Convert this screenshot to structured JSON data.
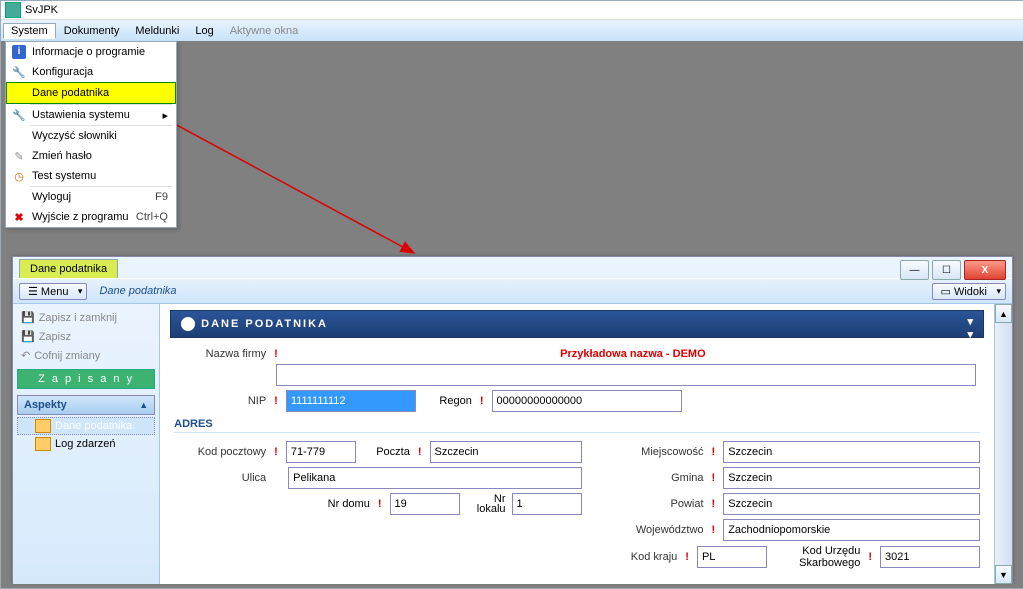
{
  "title": "SvJPK",
  "menu": {
    "system": "System",
    "dokumenty": "Dokumenty",
    "meldunki": "Meldunki",
    "log": "Log",
    "aktywne": "Aktywne okna"
  },
  "dropdown": {
    "info": "Informacje o programie",
    "konfig": "Konfiguracja",
    "dane": "Dane podatnika",
    "ustaw": "Ustawienia systemu",
    "wyczysc": "Wyczyść słowniki",
    "zmien": "Zmień hasło",
    "test": "Test systemu",
    "wyloguj": "Wyloguj",
    "wyloguj_sc": "F9",
    "wyjscie": "Wyjście z programu",
    "wyjscie_sc": "Ctrl+Q"
  },
  "child": {
    "tab": "Dane podatnika",
    "menuBtn": "Menu",
    "title": "Dane podatnika",
    "widoki": "Widoki"
  },
  "left": {
    "zapisz_zamknij": "Zapisz i zamknij",
    "zapisz": "Zapisz",
    "cofnij": "Cofnij zmiany",
    "zapisany": "Z a p i s a n y",
    "aspekty": "Aspekty",
    "tree1": "Dane podatnika",
    "tree2": "Log zdarzeń"
  },
  "section": "DANE PODATNIKA",
  "demo": "Przykładowa nazwa - DEMO",
  "labels": {
    "nazwa": "Nazwa firmy",
    "nip": "NIP",
    "regon": "Regon",
    "adres": "ADRES",
    "kod": "Kod pocztowy",
    "poczta": "Poczta",
    "ulica": "Ulica",
    "nrdomu": "Nr domu",
    "nrlokalu": "Nr\nlokalu",
    "miejsc": "Miejscowość",
    "gmina": "Gmina",
    "powiat": "Powiat",
    "woj": "Województwo",
    "kodkraju": "Kod kraju",
    "kodurz": "Kod Urzędu Skarbowego"
  },
  "values": {
    "nazwa": "",
    "nip": "1111111112",
    "regon": "00000000000000",
    "kod": "71-779",
    "poczta": "Szczecin",
    "ulica": "Pelikana",
    "nrdomu": "19",
    "nrlokalu": "1",
    "miejsc": "Szczecin",
    "gmina": "Szczecin",
    "powiat": "Szczecin",
    "woj": "Zachodniopomorskie",
    "kodkraju": "PL",
    "kodurz": "3021"
  }
}
